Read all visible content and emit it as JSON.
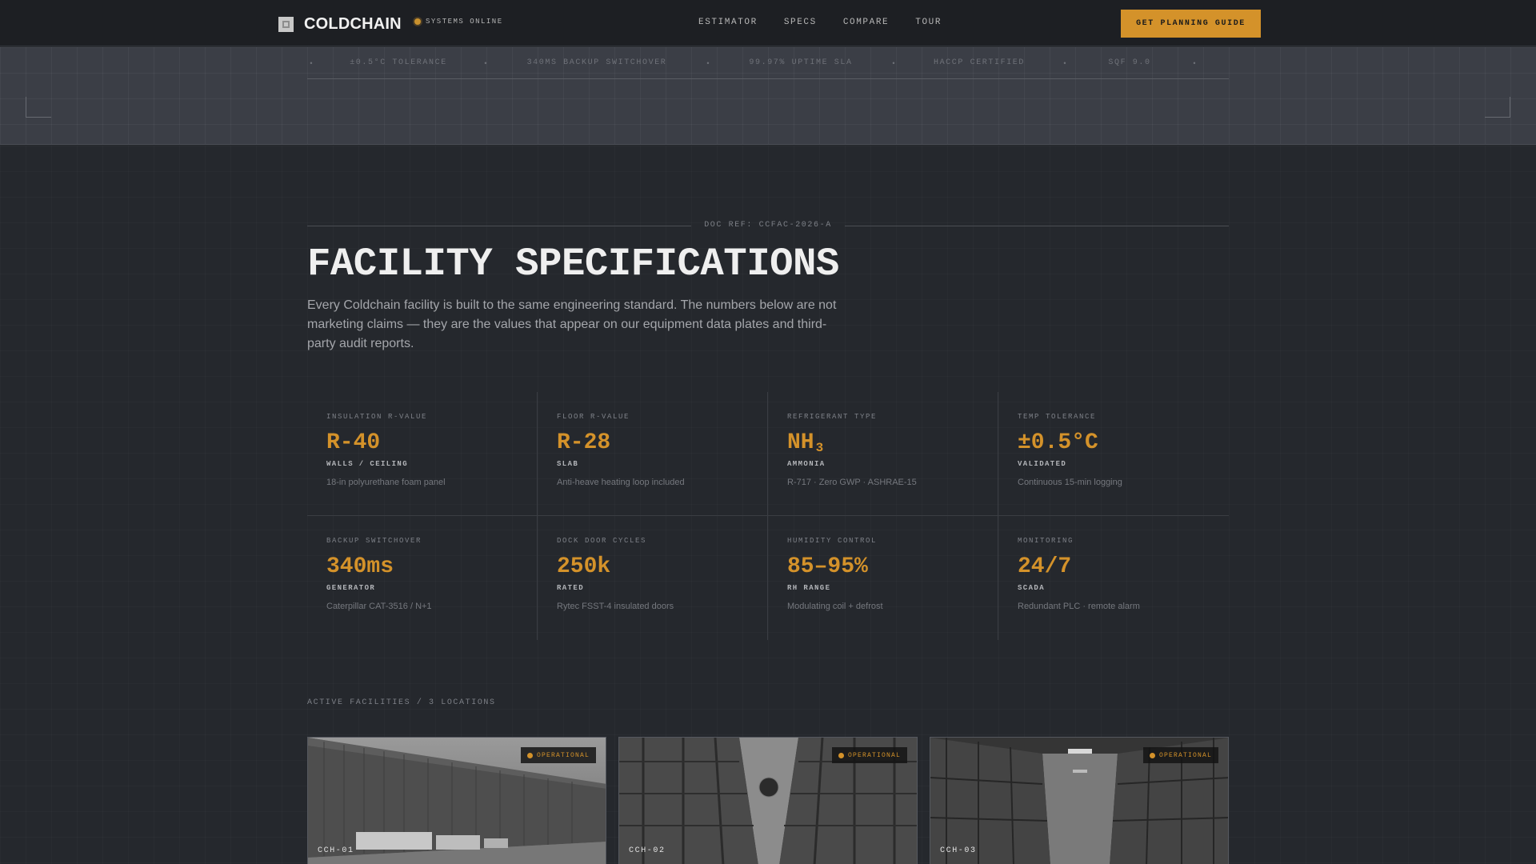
{
  "brand": {
    "name": "COLDCHAIN",
    "status": "SYSTEMS ONLINE"
  },
  "nav": {
    "links": [
      "ESTIMATOR",
      "SPECS",
      "COMPARE",
      "TOUR"
    ],
    "cta": "GET PLANNING GUIDE"
  },
  "ticker": [
    "±0.5°C TOLERANCE",
    "340MS BACKUP SWITCHOVER",
    "99.97% UPTIME SLA",
    "HACCP CERTIFIED",
    "SQF 9.0"
  ],
  "doc_ref": "DOC REF: CCFAC-2026-A",
  "title": "FACILITY SPECIFICATIONS",
  "intro": "Every Coldchain facility is built to the same engineering standard. The numbers below are not marketing claims — they are the values that appear on our equipment data plates and third-party audit reports.",
  "specs": [
    {
      "label": "INSULATION R-VALUE",
      "value": "R-40",
      "unit": "WALLS / CEILING",
      "note": "18-in polyurethane foam panel"
    },
    {
      "label": "FLOOR R-VALUE",
      "value": "R-28",
      "unit": "SLAB",
      "note": "Anti-heave heating loop included"
    },
    {
      "label": "REFRIGERANT TYPE",
      "value": "NH",
      "value_sub": "3",
      "unit": "AMMONIA",
      "note": "R-717 · Zero GWP · ASHRAE-15"
    },
    {
      "label": "TEMP TOLERANCE",
      "value": "±0.5°C",
      "unit": "VALIDATED",
      "note": "Continuous 15-min logging"
    },
    {
      "label": "BACKUP SWITCHOVER",
      "value": "340ms",
      "unit": "GENERATOR",
      "note": "Caterpillar CAT-3516 / N+1"
    },
    {
      "label": "DOCK DOOR CYCLES",
      "value": "250k",
      "unit": "RATED",
      "note": "Rytec FSST-4 insulated doors"
    },
    {
      "label": "HUMIDITY CONTROL",
      "value": "85–95%",
      "unit": "RH RANGE",
      "note": "Modulating coil + defrost"
    },
    {
      "label": "MONITORING",
      "value": "24/7",
      "unit": "SCADA",
      "note": "Redundant PLC · remote alarm"
    }
  ],
  "facilities": {
    "label": "ACTIVE FACILITIES / 3 LOCATIONS",
    "cards": [
      {
        "id": "CCH-01",
        "status": "OPERATIONAL"
      },
      {
        "id": "CCH-02",
        "status": "OPERATIONAL"
      },
      {
        "id": "CCH-03",
        "status": "OPERATIONAL"
      }
    ]
  },
  "colors": {
    "accent": "#d4922a",
    "background": "#25282d",
    "nav": "#1d1f23"
  }
}
